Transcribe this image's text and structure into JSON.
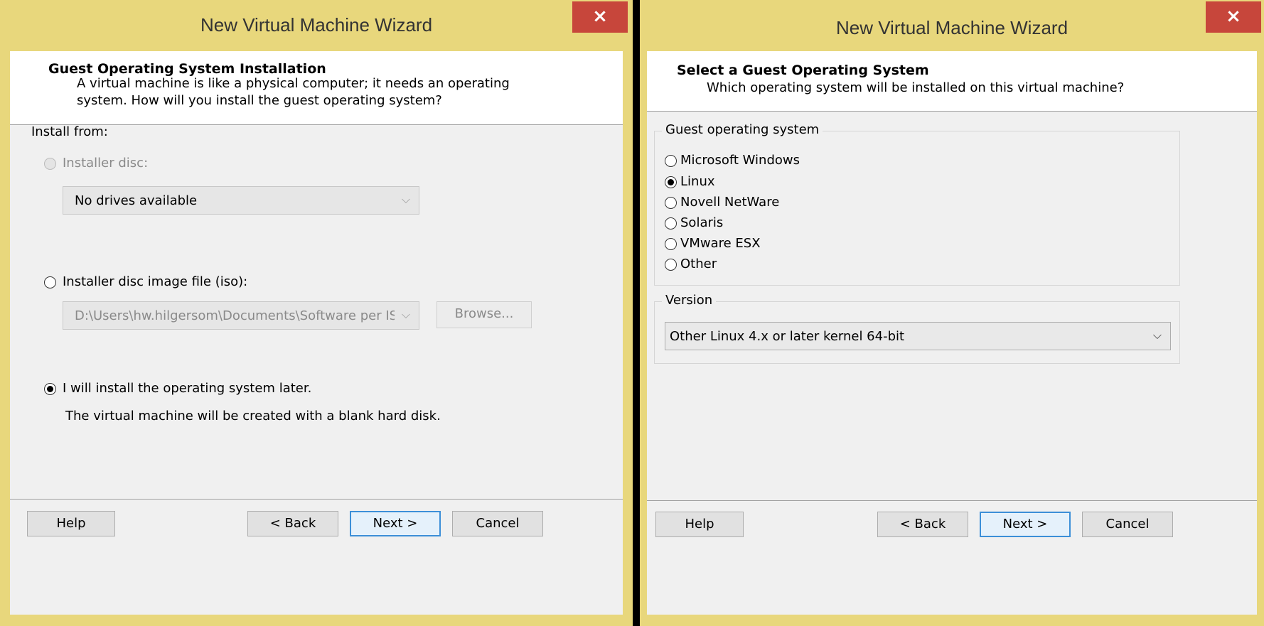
{
  "left_window": {
    "title": "New Virtual Machine Wizard",
    "close_glyph": "×",
    "header": {
      "title": "Guest Operating System Installation",
      "desc_line1": "A virtual machine is like a physical computer; it needs an operating",
      "desc_line2": "system. How will you install the guest operating system?"
    },
    "install_from_label": "Install from:",
    "option_disc": {
      "label": "Installer disc:",
      "selected": false,
      "enabled": false
    },
    "disc_combo": {
      "value": "No drives available",
      "arrow": "⌵"
    },
    "option_iso": {
      "label": "Installer disc image file (iso):",
      "selected": false
    },
    "iso_combo": {
      "value": "D:\\Users\\hw.hilgersom\\Documents\\Software per ISO\\",
      "arrow": "⌵"
    },
    "browse_label": "Browse...",
    "option_later": {
      "label": "I will install the operating system later.",
      "selected": true
    },
    "later_note": "The virtual machine will be created with a blank hard disk.",
    "buttons": {
      "help": "Help",
      "back": "< Back",
      "next": "Next >",
      "cancel": "Cancel"
    }
  },
  "right_window": {
    "title": "New Virtual Machine Wizard",
    "close_glyph": "×",
    "header": {
      "title": "Select a Guest Operating System",
      "desc_line1": "Which operating system will be installed on this virtual machine?"
    },
    "guest_os_group": {
      "legend": "Guest operating system",
      "options": [
        {
          "label": "Microsoft Windows",
          "selected": false
        },
        {
          "label": "Linux",
          "selected": true
        },
        {
          "label": "Novell NetWare",
          "selected": false
        },
        {
          "label": "Solaris",
          "selected": false
        },
        {
          "label": "VMware ESX",
          "selected": false
        },
        {
          "label": "Other",
          "selected": false
        }
      ]
    },
    "version_group": {
      "legend": "Version",
      "value": "Other Linux 4.x or later kernel 64-bit",
      "arrow": "⌵"
    },
    "buttons": {
      "help": "Help",
      "back": "< Back",
      "next": "Next >",
      "cancel": "Cancel"
    }
  },
  "colors": {
    "title_bar": "#e8d77c",
    "close_button": "#c7463b",
    "dialog_bg": "#f0f0f0",
    "default_button_border": "#3c8fd8"
  }
}
